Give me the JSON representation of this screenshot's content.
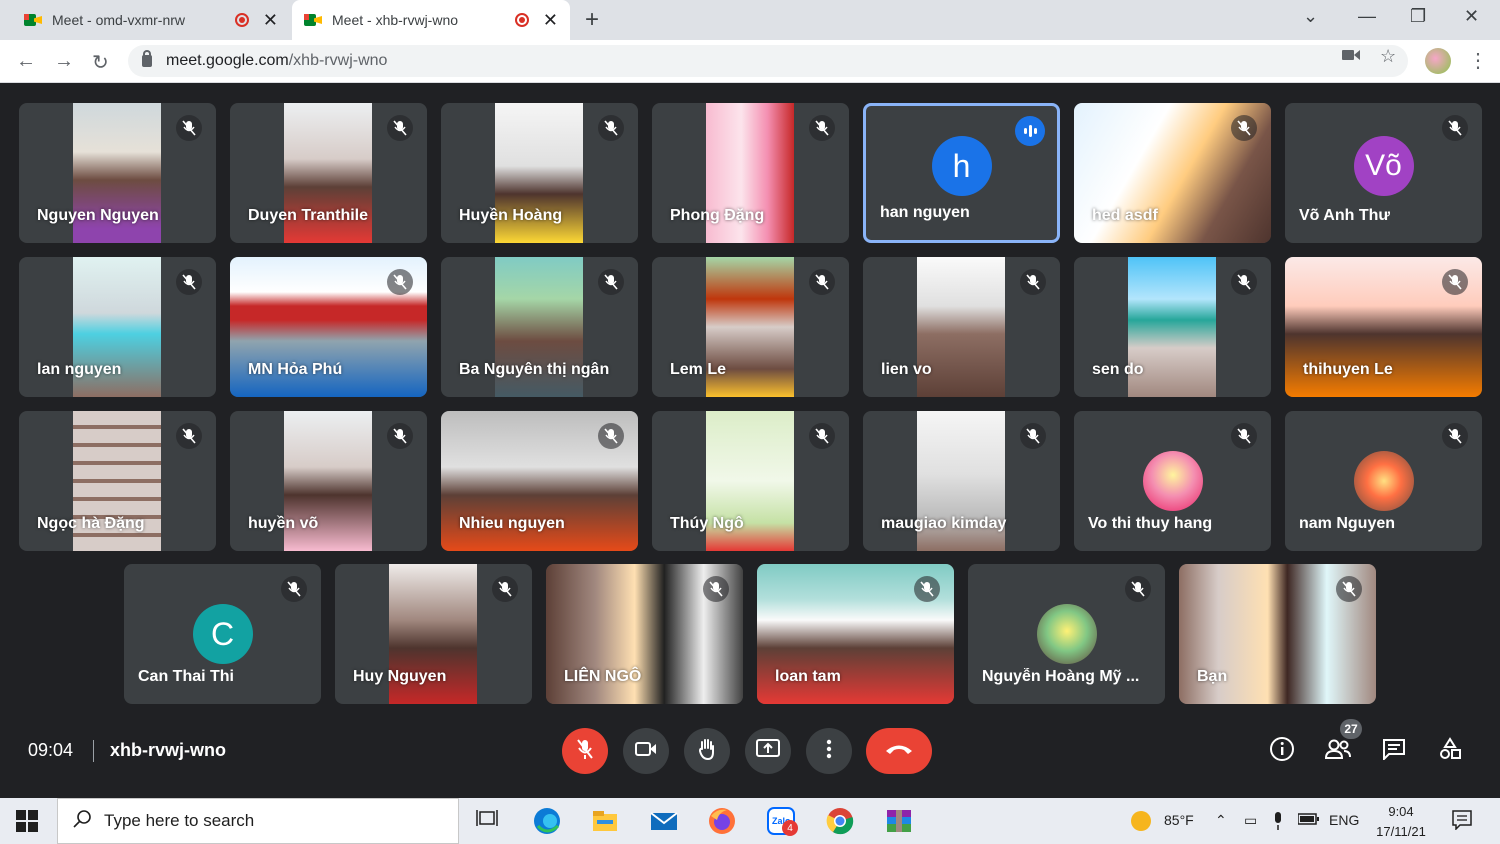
{
  "browser": {
    "tabs": [
      {
        "title": "Meet - omd-vxmr-nrw",
        "active": false
      },
      {
        "title": "Meet - xhb-rvwj-wno",
        "active": true
      }
    ],
    "new_tab": "+",
    "url_host": "meet.google.com",
    "url_path": "/xhb-rvwj-wno"
  },
  "participants_row1": [
    {
      "name": "Nguyen Nguyen",
      "type": "video"
    },
    {
      "name": "Duyen Tranthile",
      "type": "video"
    },
    {
      "name": "Huyền Hoàng",
      "type": "video"
    },
    {
      "name": "Phong Đặng",
      "type": "video"
    },
    {
      "name": "han nguyen",
      "type": "avatar",
      "initial": "h",
      "speaking": true
    },
    {
      "name": "hed asdf",
      "type": "video"
    },
    {
      "name": "Võ Anh Thư",
      "type": "avatar",
      "initial": "Võ"
    }
  ],
  "participants_row2": [
    {
      "name": "lan nguyen",
      "type": "video"
    },
    {
      "name": "MN Hỏa Phú",
      "type": "video"
    },
    {
      "name": "Ba Nguyên thị ngân",
      "type": "video"
    },
    {
      "name": "Lem Le",
      "type": "video"
    },
    {
      "name": "lien vo",
      "type": "video"
    },
    {
      "name": "sen do",
      "type": "video"
    },
    {
      "name": "thihuyen Le",
      "type": "video"
    }
  ],
  "participants_row3": [
    {
      "name": "Ngọc hà Đặng",
      "type": "video"
    },
    {
      "name": "huyền võ",
      "type": "video"
    },
    {
      "name": "Nhieu nguyen",
      "type": "video"
    },
    {
      "name": "Thúy Ngô",
      "type": "video"
    },
    {
      "name": "maugiao kimday",
      "type": "video"
    },
    {
      "name": "Vo thi thuy hang",
      "type": "photo"
    },
    {
      "name": "nam Nguyen",
      "type": "photo"
    }
  ],
  "participants_row4": [
    {
      "name": "Can Thai Thi",
      "type": "avatar",
      "initial": "C"
    },
    {
      "name": "Huy Nguyen",
      "type": "video"
    },
    {
      "name": "LIÊN NGÔ",
      "type": "video"
    },
    {
      "name": "loan tam",
      "type": "video"
    },
    {
      "name": "Nguyễn Hoàng Mỹ ...",
      "type": "photo"
    },
    {
      "name": "Bạn",
      "type": "video"
    }
  ],
  "meeting": {
    "time": "09:04",
    "code": "xhb-rvwj-wno",
    "participant_count": "27"
  },
  "colors": {
    "background": "#202124",
    "tile": "#3c4043",
    "red": "#ea4335",
    "speaking_border": "#8ab4f8"
  },
  "taskbar": {
    "search_placeholder": "Type here to search",
    "weather": "85°F",
    "lang": "ENG",
    "time": "9:04",
    "date": "17/11/21",
    "zalo_badge": "4"
  }
}
